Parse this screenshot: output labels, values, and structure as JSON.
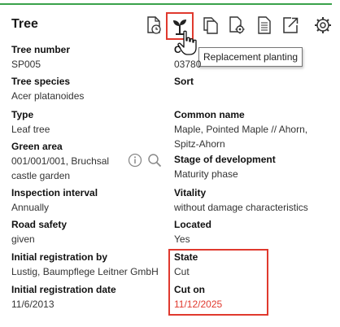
{
  "header": {
    "title": "Tree",
    "toolbar": [
      {
        "name": "history-icon"
      },
      {
        "name": "replacement-planting-icon",
        "highlighted": true
      },
      {
        "name": "copy-icon"
      },
      {
        "name": "document-settings-icon"
      },
      {
        "name": "document-icon"
      },
      {
        "name": "export-icon"
      },
      {
        "name": "gear-icon"
      }
    ],
    "tooltip": "Replacement planting",
    "accent_color": "#3aa24b",
    "highlight_color": "#e0392e"
  },
  "fields": {
    "tree_number": {
      "label": "Tree number",
      "value": "SP005"
    },
    "col2_top": {
      "label": "C",
      "value": "03780"
    },
    "tree_species": {
      "label": "Tree species",
      "value": "Acer platanoides"
    },
    "sort": {
      "label": "Sort",
      "value": ""
    },
    "type": {
      "label": "Type",
      "value": "Leaf tree"
    },
    "common_name": {
      "label": "Common name",
      "value": "Maple, Pointed Maple // Ahorn, Spitz-Ahorn"
    },
    "green_area": {
      "label": "Green area",
      "value": "001/001/001, Bruchsal castle garden"
    },
    "stage": {
      "label": "Stage of development",
      "value": "Maturity phase"
    },
    "inspection_interval": {
      "label": "Inspection interval",
      "value": "Annually"
    },
    "vitality": {
      "label": "Vitality",
      "value": "without damage characteristics"
    },
    "road_safety": {
      "label": "Road safety",
      "value": "given"
    },
    "located": {
      "label": "Located",
      "value": "Yes"
    },
    "initial_registration_by": {
      "label": "Initial registration by",
      "value": "Lustig, Baumpflege Leitner GmbH"
    },
    "state": {
      "label": "State",
      "value": "Cut"
    },
    "initial_registration_date": {
      "label": "Initial registration date",
      "value": "11/6/2013"
    },
    "cut_on": {
      "label": "Cut on",
      "value": "11/12/2025"
    }
  }
}
